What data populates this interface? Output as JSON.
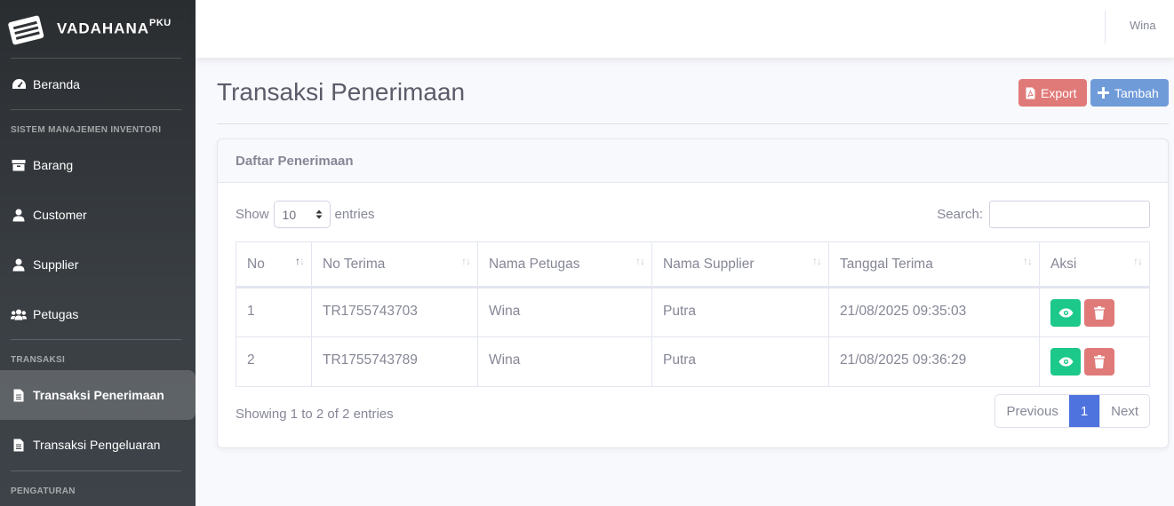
{
  "brand": {
    "name": "VADAHANA",
    "suffix": "PKU",
    "logo_icon": "book-stack-icon"
  },
  "sidebar": {
    "items": [
      {
        "label": "Beranda",
        "icon": "tachometer-icon"
      },
      {
        "label": "Barang",
        "icon": "box-icon"
      },
      {
        "label": "Customer",
        "icon": "user-icon"
      },
      {
        "label": "Supplier",
        "icon": "user-icon"
      },
      {
        "label": "Petugas",
        "icon": "users-icon"
      },
      {
        "label": "Transaksi Penerimaan",
        "icon": "file-icon",
        "active": true
      },
      {
        "label": "Transaksi Pengeluaran",
        "icon": "file-icon"
      }
    ],
    "headings": [
      "SISTEM MANAJEMEN INVENTORI",
      "TRANSAKSI",
      "PENGATURAN"
    ]
  },
  "topbar": {
    "user": "Wina"
  },
  "page": {
    "title": "Transaksi Penerimaan",
    "export_label": "Export",
    "add_label": "Tambah"
  },
  "card": {
    "title": "Daftar Penerimaan",
    "show_label": "Show",
    "entries_value": "10",
    "entries_label": "entries",
    "search_label": "Search:",
    "search_value": "",
    "columns": [
      "No",
      "No Terima",
      "Nama Petugas",
      "Nama Supplier",
      "Tanggal Terima",
      "Aksi"
    ],
    "rows": [
      {
        "no": "1",
        "no_terima": "TR1755743703",
        "petugas": "Wina",
        "supplier": "Putra",
        "tanggal": "21/08/2025 09:35:03"
      },
      {
        "no": "2",
        "no_terima": "TR1755743789",
        "petugas": "Wina",
        "supplier": "Putra",
        "tanggal": "21/08/2025 09:36:29"
      }
    ],
    "showing": "Showing 1 to 2 of 2 entries",
    "pagination": {
      "previous": "Previous",
      "current": "1",
      "next": "Next"
    }
  },
  "colors": {
    "primary": "#4e73df",
    "success": "#1cc88a",
    "danger": "#e07a79",
    "info": "#6f9bd9"
  }
}
